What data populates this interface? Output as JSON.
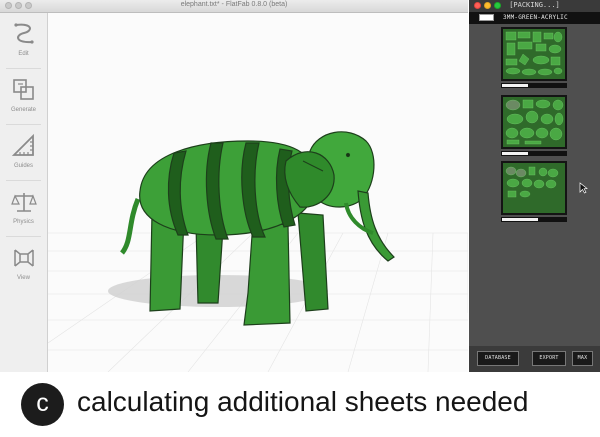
{
  "main_window": {
    "title": "elephant.txt* - FlatFab 0.8.0 (beta)",
    "tools": [
      {
        "label": "Edit",
        "icon": "edit-curve-icon"
      },
      {
        "label": "Generate",
        "icon": "generate-icon"
      },
      {
        "label": "Guides",
        "icon": "guides-ruler-icon"
      },
      {
        "label": "Physics",
        "icon": "physics-scale-icon"
      },
      {
        "label": "View",
        "icon": "view-cube-icon"
      }
    ],
    "viewport": {
      "model": "green laser-cut elephant",
      "model_color": "#3a9a35"
    }
  },
  "packing_window": {
    "title": "[PACKING...]",
    "material_label": "3MM-GREEN-ACRYLIC",
    "sheets": [
      {
        "progress": 0.4
      },
      {
        "progress": 0.4
      },
      {
        "progress": 0.55
      }
    ],
    "buttons": {
      "database": "DATABASE",
      "export": "EXPORT",
      "max": "MAX"
    },
    "sheet_color": "#2f6a2a"
  },
  "caption": {
    "badge": "c",
    "text": "calculating additional sheets needed"
  }
}
